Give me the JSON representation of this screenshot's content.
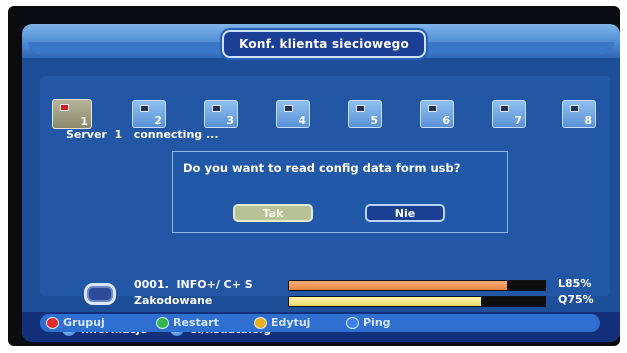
{
  "window": {
    "title": "Konf. klienta sieciowego"
  },
  "server_tiles": [
    {
      "number": "1",
      "active": true
    },
    {
      "number": "2",
      "active": false
    },
    {
      "number": "3",
      "active": false
    },
    {
      "number": "4",
      "active": false
    },
    {
      "number": "5",
      "active": false
    },
    {
      "number": "6",
      "active": false
    },
    {
      "number": "7",
      "active": false
    },
    {
      "number": "8",
      "active": false
    }
  ],
  "server_status": {
    "label": "Server",
    "number": "1",
    "status": "connecting ..."
  },
  "dialog": {
    "message": "Do you want to read config data form usb?",
    "yes_label": "Tak",
    "no_label": "Nie",
    "selected": "yes"
  },
  "channel": {
    "line1": "0001.  INFO+/ C+ S",
    "line2": "Zakodowane",
    "level_label": "L85%",
    "level_value": 0.85,
    "quality_label": "Q75%",
    "quality_value": 0.75
  },
  "info": {
    "info_label": "Informacje",
    "path_label": "C:/hsdata.cfg"
  },
  "footer_buttons": [
    {
      "label": "Grupuj",
      "color": "#e02a2a",
      "icon": "red-button-icon"
    },
    {
      "label": "Restart",
      "color": "#34b84c",
      "icon": "green-button-icon"
    },
    {
      "label": "Edytuj",
      "color": "#e8b021",
      "icon": "yellow-button-icon"
    },
    {
      "label": "Ping",
      "color": "#3b7ff0",
      "icon": "blue-button-icon"
    }
  ],
  "colors": {
    "screen_bg": "#1d4e98",
    "accent": "#3a77c6",
    "level_bar": "#ee8440",
    "quality_bar": "#efd866"
  }
}
